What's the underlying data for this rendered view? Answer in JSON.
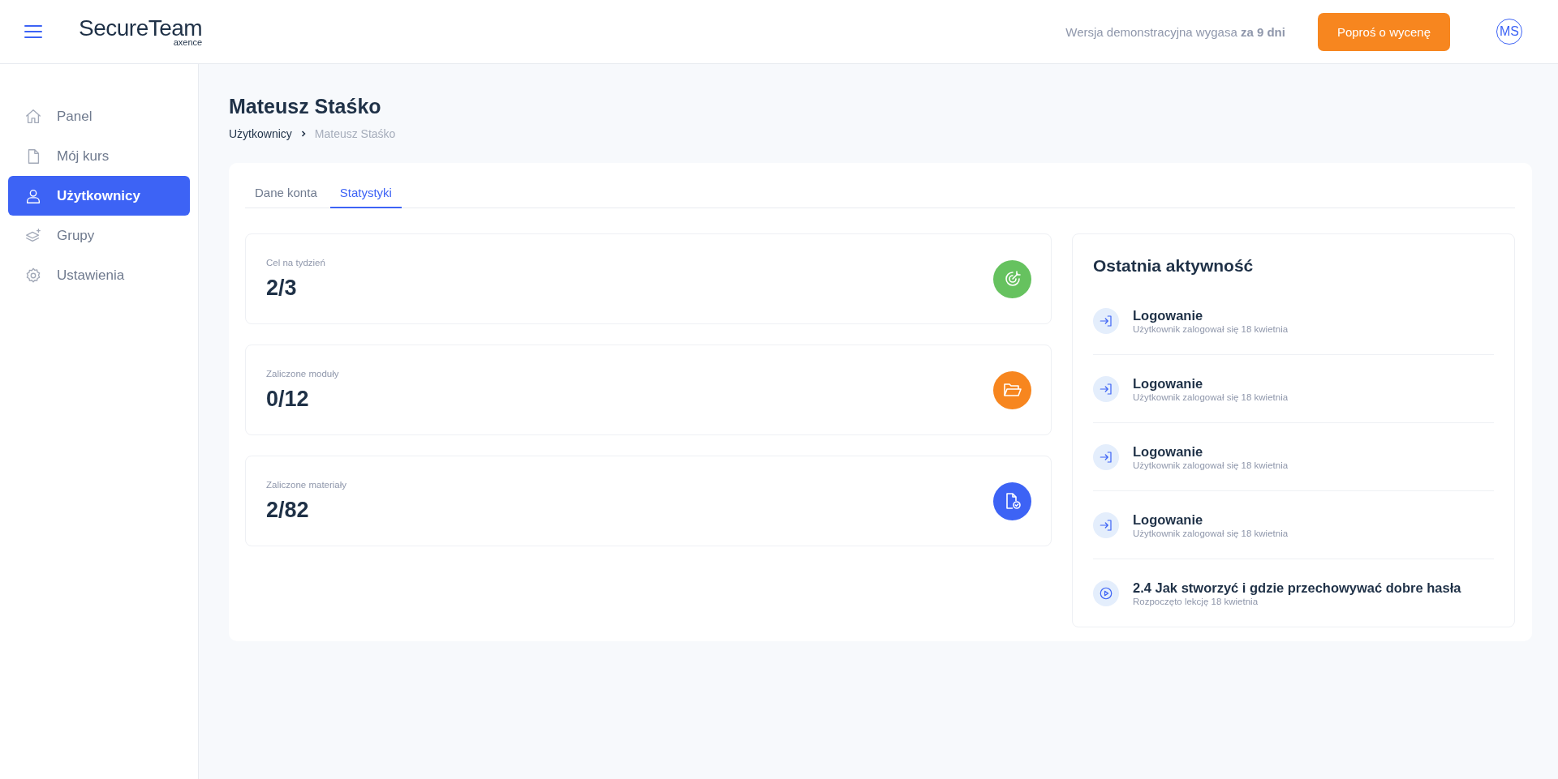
{
  "header": {
    "logo": {
      "name": "SecureTeam",
      "maker": "axence"
    },
    "trial_notice": "Wersja demonstracyjna wygasa **za 9 dni**",
    "quote_button": "Poproś o wycenę",
    "avatar": "MS"
  },
  "sidebar": {
    "items": [
      {
        "label": "Panel",
        "kind": "home",
        "selected": false
      },
      {
        "label": "Mój kurs",
        "kind": "file",
        "selected": false
      },
      {
        "label": "Użytkownicy",
        "kind": "user",
        "selected": true
      },
      {
        "label": "Grupy",
        "kind": "layers",
        "selected": false
      },
      {
        "label": "Ustawienia",
        "kind": "gear",
        "selected": false
      }
    ]
  },
  "page": {
    "title": "Mateusz Staśko",
    "breadcrumb": [
      "Użytkownicy",
      "Mateusz Staśko"
    ]
  },
  "tabs": [
    {
      "label": "Dane konta",
      "selected": false
    },
    {
      "label": "Statystyki",
      "selected": true
    }
  ],
  "stats": [
    {
      "label": "Cel na tydzień",
      "value": "2/3",
      "kind": "target",
      "color": "#66c25f"
    },
    {
      "label": "Zaliczone moduły",
      "value": "0/12",
      "kind": "folder",
      "color": "#f7861f"
    },
    {
      "label": "Zaliczone materiały",
      "value": "2/82",
      "kind": "document",
      "color": "#3d63f5"
    }
  ],
  "activity": {
    "title": "Ostatnia aktywność",
    "items": [
      {
        "kind": "login",
        "title": "Logowanie",
        "detail": "Użytkownik zalogował się 18 kwietnia"
      },
      {
        "kind": "login",
        "title": "Logowanie",
        "detail": "Użytkownik zalogował się 18 kwietnia"
      },
      {
        "kind": "login",
        "title": "Logowanie",
        "detail": "Użytkownik zalogował się 18 kwietnia"
      },
      {
        "kind": "login",
        "title": "Logowanie",
        "detail": "Użytkownik zalogował się 18 kwietnia"
      },
      {
        "kind": "lesson",
        "title": "2.4 Jak stworzyć i gdzie przechowywać dobre hasła",
        "detail": "Rozpoczęto lekcję 18 kwietnia"
      }
    ]
  }
}
